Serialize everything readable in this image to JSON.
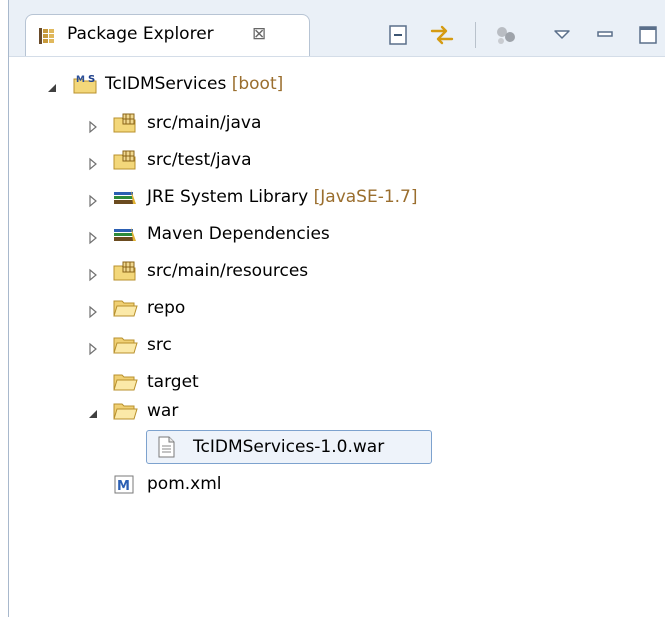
{
  "view": {
    "title": "Package Explorer",
    "close_glyph": "⊠"
  },
  "toolbar": {
    "icons": [
      "collapse-all-icon",
      "link-with-editor-icon",
      "focus-active-task-icon",
      "view-menu-icon",
      "minimize-icon",
      "maximize-icon"
    ]
  },
  "tree": {
    "project": {
      "name": "TcIDMServices",
      "decoration": "[boot]"
    },
    "items": [
      {
        "label": "src/main/java",
        "decoration": ""
      },
      {
        "label": "src/test/java",
        "decoration": ""
      },
      {
        "label": "JRE System Library",
        "decoration": "[JavaSE-1.7]"
      },
      {
        "label": "Maven Dependencies",
        "decoration": ""
      },
      {
        "label": "src/main/resources",
        "decoration": ""
      },
      {
        "label": "repo",
        "decoration": ""
      },
      {
        "label": "src",
        "decoration": ""
      },
      {
        "label": "target",
        "decoration": ""
      },
      {
        "label": "war",
        "decoration": ""
      },
      {
        "label": "TcIDMServices-1.0.war",
        "decoration": ""
      },
      {
        "label": "pom.xml",
        "decoration": ""
      }
    ]
  },
  "colors": {
    "header_bg": "#eaf0f7",
    "selection_border": "#7da2ce",
    "decoration": "#9a6e2e",
    "folder_yellow": "#f3d77a"
  }
}
